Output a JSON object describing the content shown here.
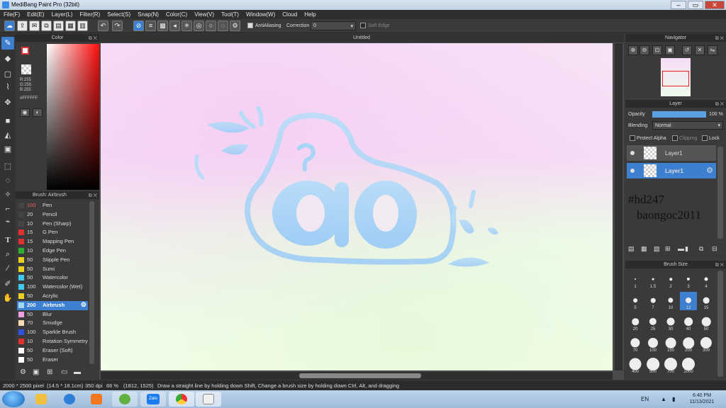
{
  "window": {
    "title": "MediBang Paint Pro (32bit)",
    "minimize": "–",
    "maximize": "▭",
    "close": "✕"
  },
  "menu": [
    "File(F)",
    "Edit(E)",
    "Layer(L)",
    "Filter(R)",
    "Select(S)",
    "Snap(N)",
    "Color(C)",
    "View(V)",
    "Tool(T)",
    "Window(W)",
    "Cloud",
    "Help"
  ],
  "toolbar": {
    "antialiasing_label": "AntiAliasing",
    "correction_label": "Correction",
    "correction_value": "0",
    "soft_edge_label": "Soft Edge"
  },
  "color_panel": {
    "title": "Color",
    "r": "R:255",
    "g": "G:255",
    "b": "B:255",
    "hex": "#FFFFFF",
    "primary_color": "#ffffff",
    "secondary_color": "#e8303a"
  },
  "brush_panel": {
    "title": "Brush: Airbrush",
    "items": [
      {
        "size": "100",
        "name": "Pen",
        "color": "#444444"
      },
      {
        "size": "20",
        "name": "Pencil",
        "color": "#444444"
      },
      {
        "size": "10",
        "name": "Pen (Sharp)",
        "color": "#444444"
      },
      {
        "size": "15",
        "name": "G Pen",
        "color": "#e03030"
      },
      {
        "size": "15",
        "name": "Mapping Pen",
        "color": "#e03030"
      },
      {
        "size": "10",
        "name": "Edge Pen",
        "color": "#30b030"
      },
      {
        "size": "50",
        "name": "Stipple Pen",
        "color": "#e8d020"
      },
      {
        "size": "50",
        "name": "Sumi",
        "color": "#e8d020"
      },
      {
        "size": "50",
        "name": "Watercolor",
        "color": "#40c8f0"
      },
      {
        "size": "100",
        "name": "Watercolor (Wet)",
        "color": "#40c8f0"
      },
      {
        "size": "50",
        "name": "Acrylic",
        "color": "#e8d020"
      },
      {
        "size": "200",
        "name": "Airbrush",
        "color": "#a0d8f0"
      },
      {
        "size": "50",
        "name": "Blur",
        "color": "#f0a0e0"
      },
      {
        "size": "70",
        "name": "Smudge",
        "color": "#f8d8b0"
      },
      {
        "size": "100",
        "name": "Sparkle Brush",
        "color": "#3050e0"
      },
      {
        "size": "10",
        "name": "Rotation Symmetry",
        "color": "#e03030"
      },
      {
        "size": "50",
        "name": "Eraser (Soft)",
        "color": "#ffffff"
      },
      {
        "size": "50",
        "name": "Eraser",
        "color": "#ffffff"
      }
    ],
    "selected_index": 11
  },
  "canvas": {
    "tab": "Untitled"
  },
  "navigator": {
    "title": "Navigator"
  },
  "layer_panel": {
    "title": "Layer",
    "opacity_label": "Opacity",
    "opacity_value": "100 %",
    "opacity_fraction": 1.0,
    "blending_label": "Blending",
    "blending_value": "Normal",
    "protect_alpha": "Protect Alpha",
    "clipping": "Clipping",
    "lock": "Lock",
    "layers": [
      {
        "name": "Layer1"
      },
      {
        "name": "Layer1"
      }
    ],
    "selected_index": 1,
    "overlay_line1": "#hd247",
    "overlay_line2": "baongoc2011"
  },
  "brush_size": {
    "title": "Brush Size",
    "sizes": [
      "1",
      "1.5",
      "2",
      "3",
      "4",
      "5",
      "7",
      "10",
      "12",
      "15",
      "20",
      "25",
      "30",
      "40",
      "50",
      "70",
      "100",
      "150",
      "200",
      "300",
      "400",
      "500",
      "700",
      "1000"
    ],
    "selected_index": 8
  },
  "status": {
    "dimensions": "2000 * 2500 pixel",
    "physical": "(14.5 * 18.1cm)",
    "dpi": "350 dpi",
    "zoom": "66 %",
    "cursor": "(1812, 1525)",
    "hint": "Draw a straight line by holding down Shift, Change a brush size by holding down Ctrl, Alt, and dragging"
  },
  "taskbar": {
    "lang": "EN",
    "time": "6:40 PM",
    "date": "11/13/2021",
    "zalo": "Zalo"
  }
}
